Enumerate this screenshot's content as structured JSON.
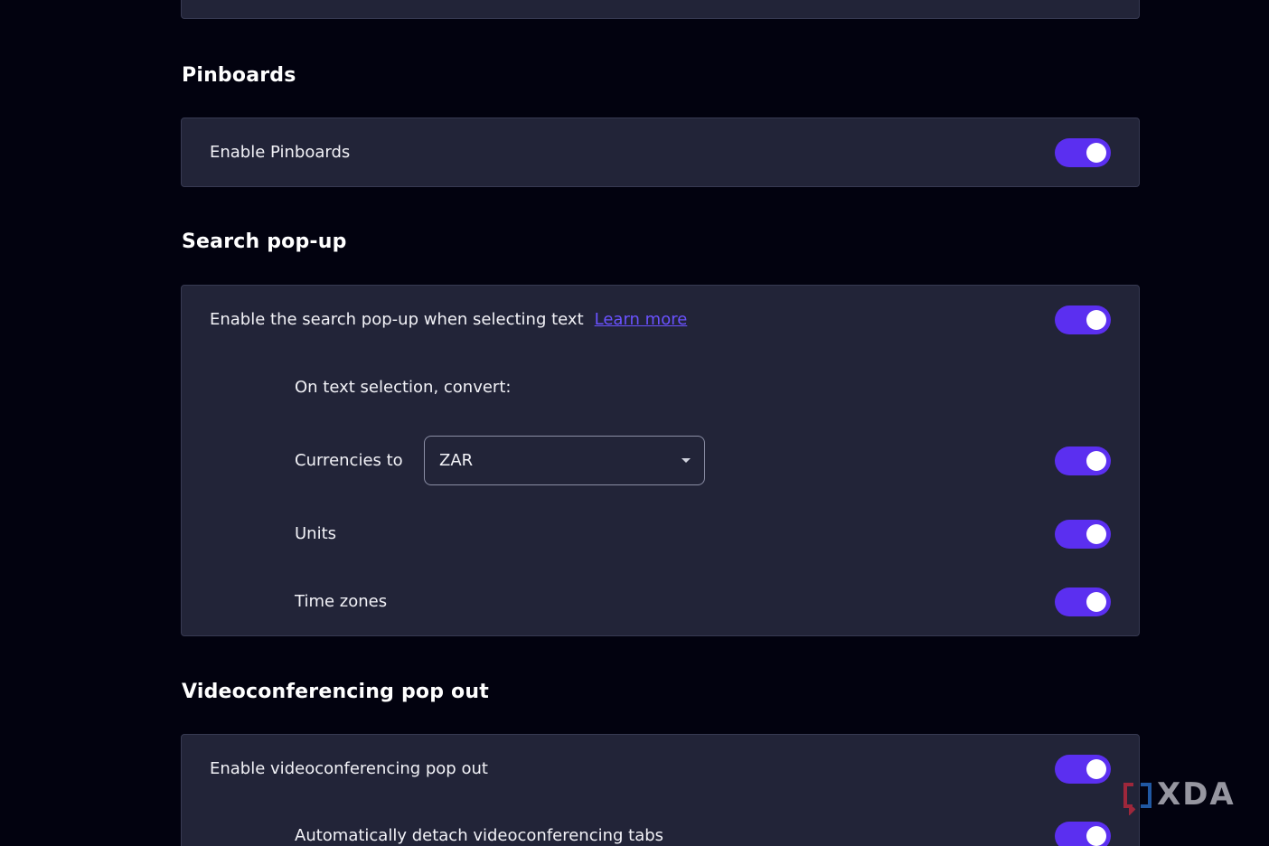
{
  "sections": {
    "pinboards": {
      "title": "Pinboards",
      "enable_label": "Enable Pinboards",
      "enable_on": true
    },
    "search_popup": {
      "title": "Search pop-up",
      "enable_label": "Enable the search pop-up when selecting text",
      "learn_more": "Learn more",
      "enable_on": true,
      "convert_heading": "On text selection, convert:",
      "currencies_label": "Currencies to",
      "currency_value": "ZAR",
      "currencies_on": true,
      "units_label": "Units",
      "units_on": true,
      "timezones_label": "Time zones",
      "timezones_on": true
    },
    "videoconferencing": {
      "title": "Videoconferencing pop out",
      "enable_label": "Enable videoconferencing pop out",
      "enable_on": true,
      "auto_detach_label": "Automatically detach videoconferencing tabs",
      "auto_detach_on": true
    }
  },
  "watermark": {
    "text": "XDA"
  },
  "colors": {
    "background": "#02020f",
    "card": "#222438",
    "accent": "#5b2ff0",
    "link": "#6a52ff"
  }
}
